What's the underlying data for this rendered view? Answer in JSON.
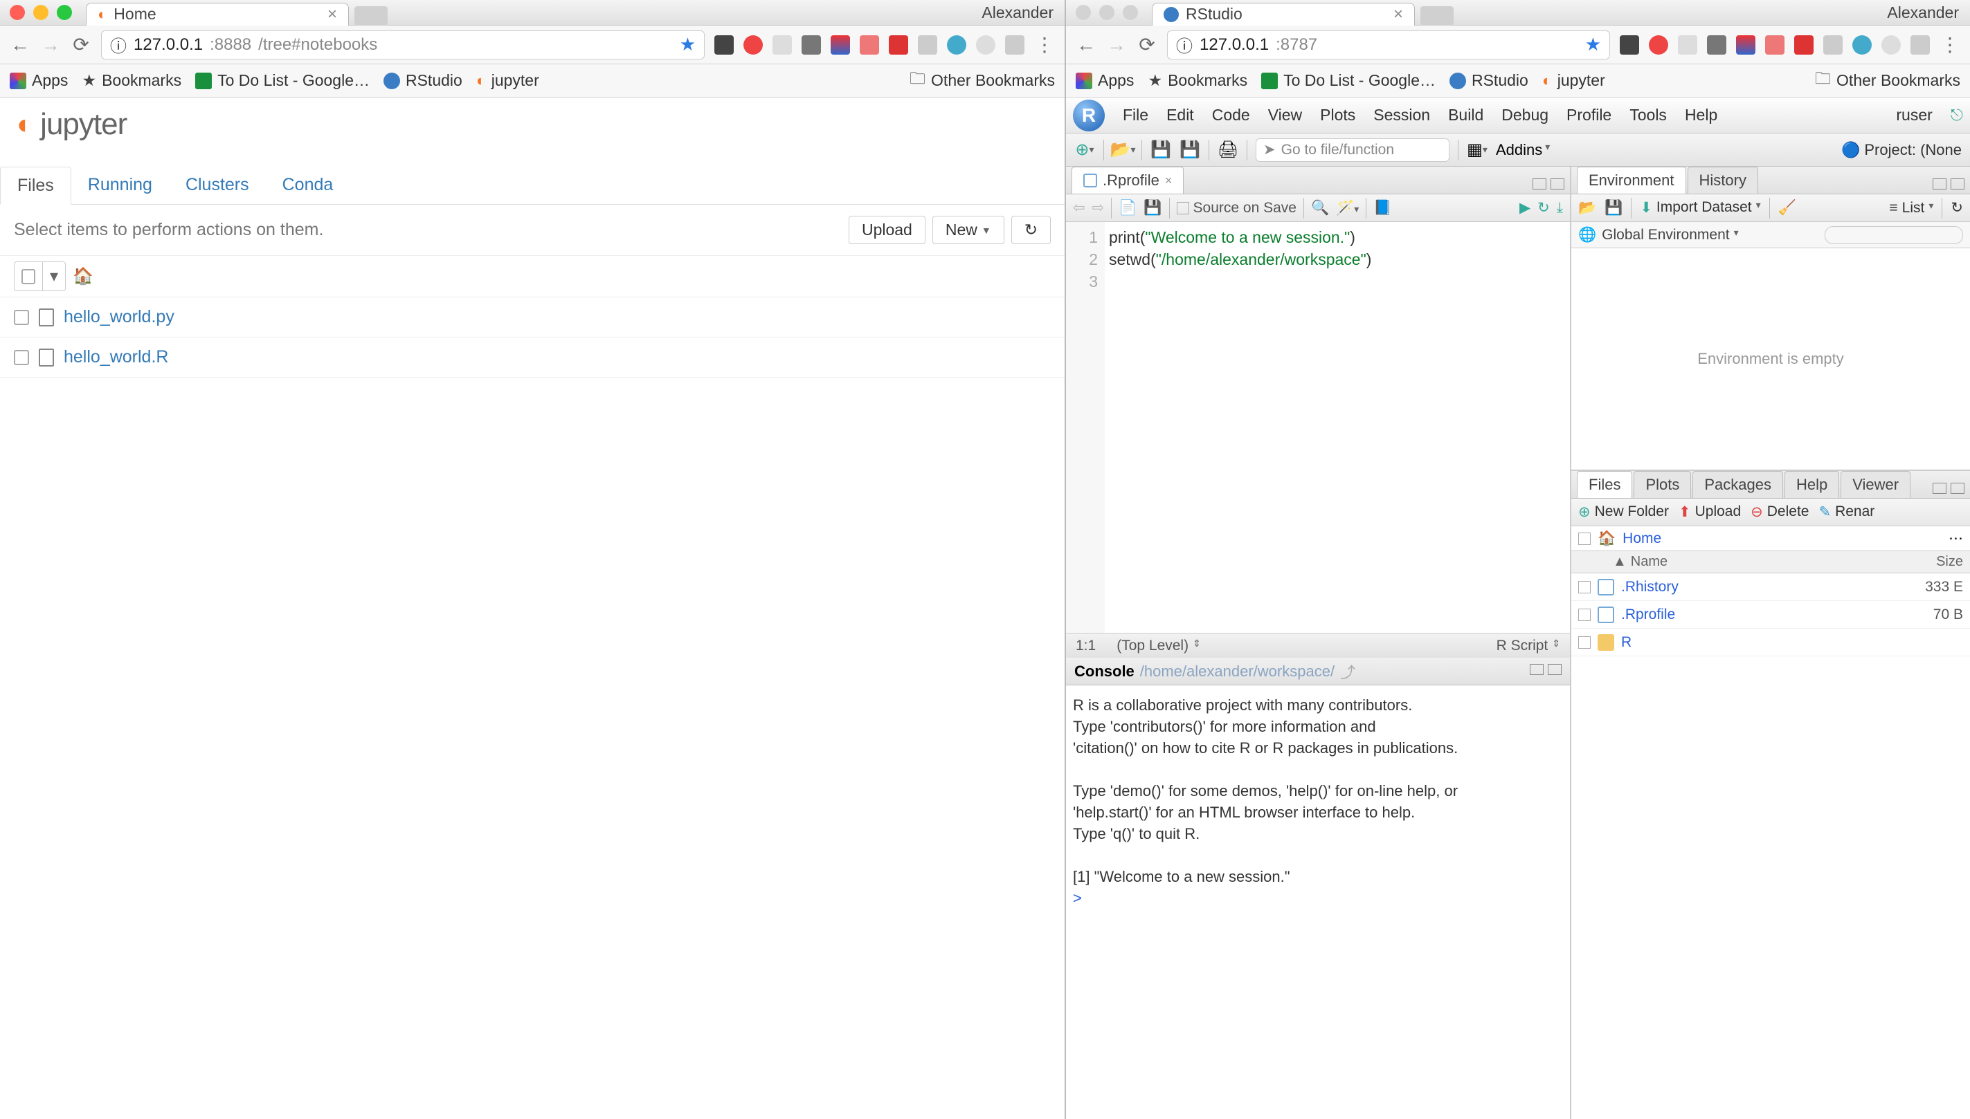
{
  "left": {
    "user": "Alexander",
    "tab_title": "Home",
    "url_host": "127.0.0.1",
    "url_port": ":8888",
    "url_path": "/tree#notebooks",
    "bookmarks": {
      "apps": "Apps",
      "bookmarks": "Bookmarks",
      "todo": "To Do List - Google…",
      "rstudio": "RStudio",
      "jupyter": "jupyter",
      "other": "Other Bookmarks"
    },
    "jupyter": {
      "logo_text": "jupyter",
      "tabs": {
        "files": "Files",
        "running": "Running",
        "clusters": "Clusters",
        "conda": "Conda"
      },
      "hint": "Select items to perform actions on them.",
      "upload": "Upload",
      "new": "New",
      "files": [
        {
          "name": "hello_world.py"
        },
        {
          "name": "hello_world.R"
        }
      ]
    }
  },
  "right": {
    "user": "Alexander",
    "tab_title": "RStudio",
    "url_host": "127.0.0.1",
    "url_port": ":8787",
    "bookmarks": {
      "apps": "Apps",
      "bookmarks": "Bookmarks",
      "todo": "To Do List - Google…",
      "rstudio": "RStudio",
      "jupyter": "jupyter",
      "other": "Other Bookmarks"
    },
    "menu": {
      "file": "File",
      "edit": "Edit",
      "code": "Code",
      "view": "View",
      "plots": "Plots",
      "session": "Session",
      "build": "Build",
      "debug": "Debug",
      "profile": "Profile",
      "tools": "Tools",
      "help": "Help",
      "user": "ruser"
    },
    "toolbar": {
      "goto": "Go to file/function",
      "addins": "Addins",
      "project": "Project: (None"
    },
    "source": {
      "tab": ".Rprofile",
      "source_on_save": "Source on Save",
      "lines": {
        "1": {
          "pre": "print(",
          "str": "\"Welcome to a new session.\"",
          "post": ")"
        },
        "2": {
          "pre": "setwd(",
          "str": "\"/home/alexander/workspace\"",
          "post": ")"
        }
      },
      "status_pos": "1:1",
      "status_scope": "(Top Level)",
      "status_type": "R Script"
    },
    "console": {
      "title": "Console",
      "path": "/home/alexander/workspace/",
      "text": "R is a collaborative project with many contributors.\nType 'contributors()' for more information and\n'citation()' on how to cite R or R packages in publications.\n\nType 'demo()' for some demos, 'help()' for on-line help, or\n'help.start()' for an HTML browser interface to help.\nType 'q()' to quit R.\n\n[1] \"Welcome to a new session.\"",
      "prompt": ">"
    },
    "env": {
      "tabs": {
        "environment": "Environment",
        "history": "History"
      },
      "import": "Import Dataset",
      "list": "List",
      "scope": "Global Environment",
      "empty": "Environment is empty"
    },
    "files": {
      "tabs": {
        "files": "Files",
        "plots": "Plots",
        "packages": "Packages",
        "help": "Help",
        "viewer": "Viewer"
      },
      "newfolder": "New Folder",
      "upload": "Upload",
      "delete": "Delete",
      "rename": "Renar",
      "home": "Home",
      "col_name": "Name",
      "col_size": "Size",
      "rows": [
        {
          "name": ".Rhistory",
          "size": "333 E"
        },
        {
          "name": ".Rprofile",
          "size": "70 B"
        },
        {
          "name": "R",
          "size": ""
        }
      ]
    }
  }
}
